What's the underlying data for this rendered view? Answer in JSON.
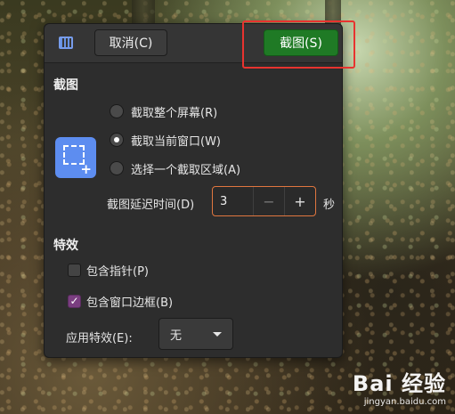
{
  "header": {
    "cancel_label": "取消(C)",
    "capture_label": "截图(S)"
  },
  "capture": {
    "section_title": "截图",
    "options": [
      {
        "label": "截取整个屏幕(R)",
        "selected": false
      },
      {
        "label": "截取当前窗口(W)",
        "selected": true
      },
      {
        "label": "选择一个截取区域(A)",
        "selected": false
      }
    ],
    "delay_label": "截图延迟时间(D)",
    "delay_value": "3",
    "delay_unit": "秒",
    "minus_glyph": "−",
    "plus_glyph": "+"
  },
  "effects": {
    "section_title": "特效",
    "include_pointer": {
      "label": "包含指针(P)",
      "checked": false
    },
    "include_border": {
      "label": "包含窗口边框(B)",
      "checked": true
    },
    "apply_effect_label": "应用特效(E):",
    "apply_effect_value": "无"
  },
  "watermark": {
    "logo": "Bai 经验",
    "site": "jingyan.baidu.com"
  },
  "colors": {
    "capture_button": "#1f7a25",
    "highlight_box": "#e8332f",
    "spin_focus": "#e0763f",
    "checkbox_checked": "#7a3e80"
  }
}
